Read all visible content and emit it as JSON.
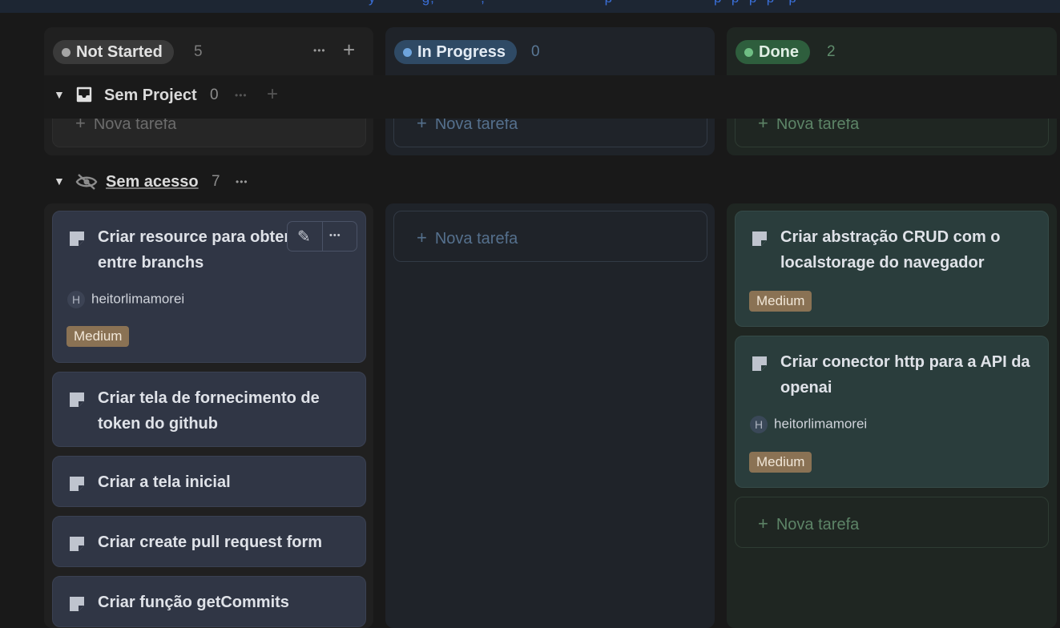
{
  "colors": {
    "background": "#191919",
    "not_started": "#a5a5a5",
    "in_progress": "#6ea4dc",
    "done": "#6fbf84",
    "tag_medium": "#8a7254"
  },
  "columns": [
    {
      "label": "Not Started",
      "count": "5"
    },
    {
      "label": "In Progress",
      "count": "0"
    },
    {
      "label": "Done",
      "count": "2"
    }
  ],
  "icons": {
    "more": "•••",
    "add": "+",
    "caret": "▼",
    "edit": "✎",
    "plus": "+"
  },
  "groups": [
    {
      "title": "Sem Project",
      "count": "0",
      "icon": "inbox-icon"
    },
    {
      "title": "Sem acesso",
      "count": "7",
      "icon": "eye-off-icon"
    }
  ],
  "new_task_label": "Nova tarefa",
  "cards": {
    "not_started": [
      {
        "title": "Criar resource para obter diffs entre branchs",
        "assignee_initial": "H",
        "assignee": "heitorlimamorei",
        "tag": "Medium"
      },
      {
        "title": "Criar tela de fornecimento de token do github"
      },
      {
        "title": "Criar a tela inicial"
      },
      {
        "title": "Criar create pull request form"
      },
      {
        "title": "Criar função getCommits"
      }
    ],
    "done": [
      {
        "title": "Criar abstração CRUD com o localstorage do navegador",
        "tag": "Medium"
      },
      {
        "title": "Criar conector http para a API da openai",
        "assignee_initial": "H",
        "assignee": "heitorlimamorei",
        "tag": "Medium"
      }
    ]
  }
}
